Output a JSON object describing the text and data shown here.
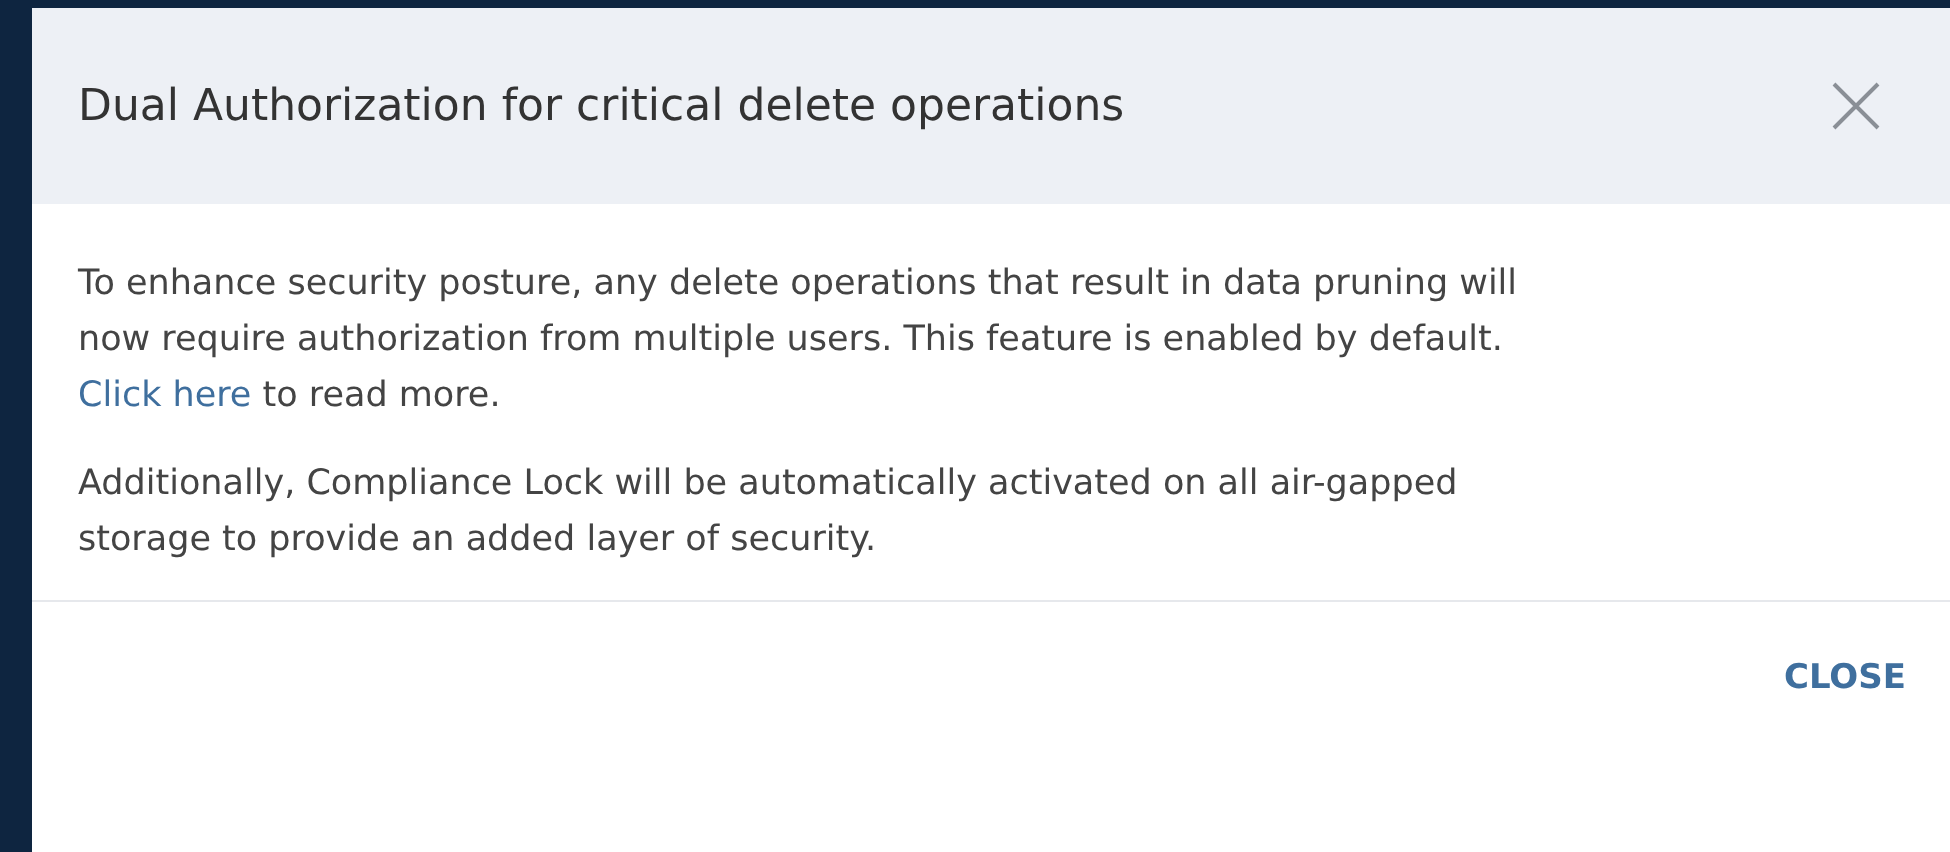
{
  "dialog": {
    "title": "Dual Authorization for critical delete operations",
    "paragraphs": [
      {
        "segments": [
          {
            "kind": "text",
            "text": "To enhance security posture, any delete operations that result in data pruning will now require authorization from multiple users. This feature is enabled by default. "
          },
          {
            "kind": "link",
            "text": "Click here"
          },
          {
            "kind": "text",
            "text": " to read more."
          }
        ]
      },
      {
        "segments": [
          {
            "kind": "text",
            "text": "Additionally, Compliance Lock will be automatically activated on all air-gapped storage to provide an added layer of security."
          }
        ]
      }
    ],
    "buttons": [
      "CLOSE"
    ]
  }
}
